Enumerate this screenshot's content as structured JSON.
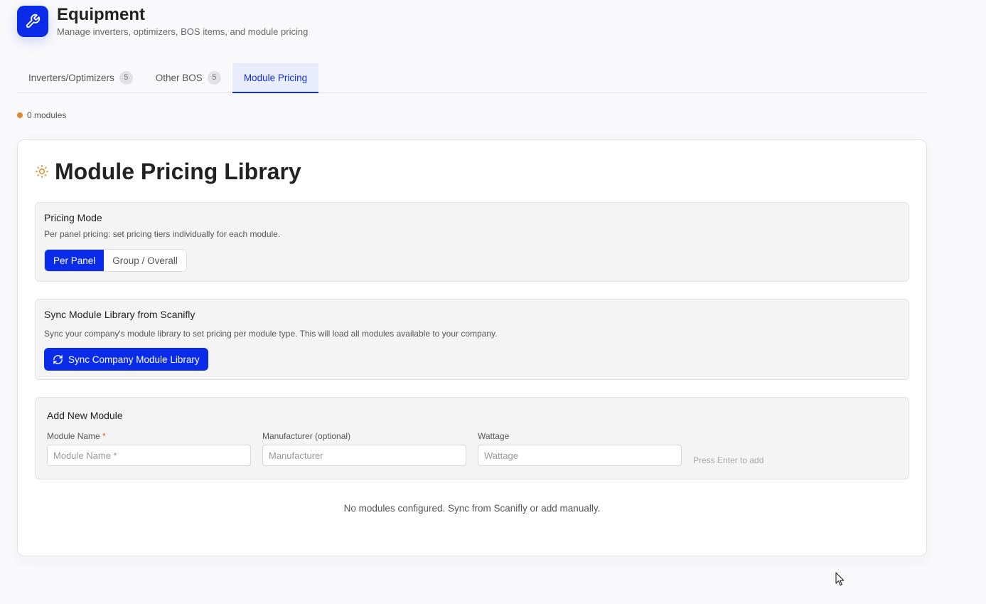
{
  "header": {
    "title": "Equipment",
    "subtitle": "Manage inverters, optimizers, BOS items, and module pricing",
    "icon": "wrench-icon",
    "accent_color": "#0a2be8"
  },
  "tabs": [
    {
      "label": "Inverters/Optimizers",
      "count": "5",
      "active": false
    },
    {
      "label": "Other BOS",
      "count": "5",
      "active": false
    },
    {
      "label": "Module Pricing",
      "active": true
    }
  ],
  "status": {
    "text": "0 modules",
    "dot_color": "#e08a2e"
  },
  "library": {
    "title": "Module Pricing Library",
    "icon": "sun-icon",
    "pricing_mode": {
      "label": "Pricing Mode",
      "description": "Per panel pricing: set pricing tiers individually for each module.",
      "options": [
        "Per Panel",
        "Group / Overall"
      ],
      "selected": "Per Panel"
    },
    "sync": {
      "label": "Sync Module Library from Scanifly",
      "description": "Sync your company's module library to set pricing per module type. This will load all modules available to your company.",
      "button_label": "Sync Company Module Library"
    },
    "add_module": {
      "label": "Add New Module",
      "module_name": {
        "label": "Module Name",
        "required_mark": "*",
        "placeholder": "Module Name *",
        "value": ""
      },
      "manufacturer": {
        "label": "Manufacturer (optional)",
        "placeholder": "Manufacturer",
        "value": ""
      },
      "wattage": {
        "label": "Wattage",
        "placeholder": "Wattage",
        "value": ""
      },
      "hint": "Press Enter to add"
    },
    "empty_message": "No modules configured. Sync from Scanifly or add manually."
  }
}
